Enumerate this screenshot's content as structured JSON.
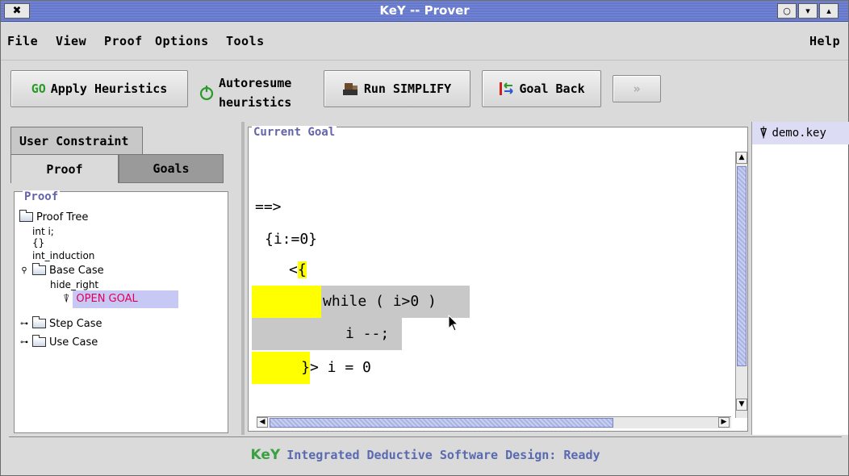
{
  "window": {
    "title": "KeY -- Prover",
    "close_glyph": "✖",
    "ctrl_glyphs": [
      "○",
      "▾",
      "▴"
    ]
  },
  "menu": {
    "items": [
      "File",
      "View",
      "Proof",
      "Options",
      "Tools"
    ],
    "help": "Help"
  },
  "toolbar": {
    "apply_heuristics": {
      "icon_text": "GO",
      "label": "Apply Heuristics"
    },
    "autoresume": {
      "line1": "Autoresume",
      "line2": "heuristics"
    },
    "run_simplify": {
      "label": "Run SIMPLIFY"
    },
    "goal_back": {
      "label": "Goal Back"
    },
    "forward_glyph": "»"
  },
  "left": {
    "tabs": {
      "user_constraint": "User Constraint",
      "proof": "Proof",
      "goals": "Goals"
    },
    "group_title": "Proof",
    "tree": {
      "root": "Proof Tree",
      "n1": "int i;",
      "n2": "{}",
      "n3": "int_induction",
      "base_case": "Base Case",
      "hide_right": "hide_right",
      "open_goal": "OPEN GOAL",
      "step_case": "Step Case",
      "use_case": "Use Case"
    }
  },
  "center": {
    "title": "Current Goal",
    "lines": {
      "l1": "==>",
      "l2": "{i:=0}",
      "l3a": "<",
      "l3b": "{",
      "l4": "while ( i>0 )",
      "l5": "i --;",
      "l6a": "}",
      "l6b": "> i = 0"
    }
  },
  "right": {
    "item": "demo.key"
  },
  "status": {
    "logo": "KeY",
    "text": "Integrated Deductive Software Design: Ready"
  },
  "colors": {
    "title_bar": "#5a6ec8",
    "highlight_yellow": "#ffff00",
    "highlight_gray": "#c8c8c8",
    "open_goal_bg": "#c8c8f4",
    "open_goal_text": "#e0005a",
    "group_title": "#6464a8"
  }
}
